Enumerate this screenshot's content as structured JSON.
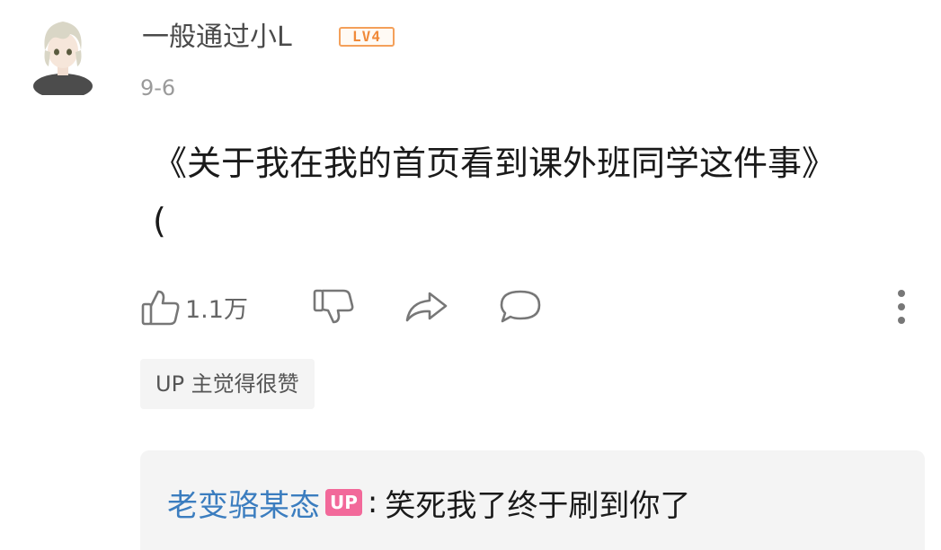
{
  "comment": {
    "username": "一般通过小L",
    "level_badge": "LV4",
    "date": "9-6",
    "text": "《关于我在我的首页看到课外班同学这件事》\n(",
    "like_count": "1.1万"
  },
  "up_liked_tag": "UP 主觉得很赞",
  "reply": {
    "author": "老变骆某态",
    "author_badge": "UP",
    "colon": ":",
    "text": "笑死我了终于刷到你了"
  },
  "icons": {
    "like": "thumbs-up-icon",
    "dislike": "thumbs-down-icon",
    "share": "share-arrow-icon",
    "reply": "speech-bubble-icon",
    "more": "vertical-dots-icon"
  },
  "colors": {
    "username": "#4a4a4a",
    "reply_author": "#3b7dbf",
    "level_badge": "#f08a3a",
    "up_badge": "#f2699a",
    "tag_background": "#f4f4f4"
  }
}
